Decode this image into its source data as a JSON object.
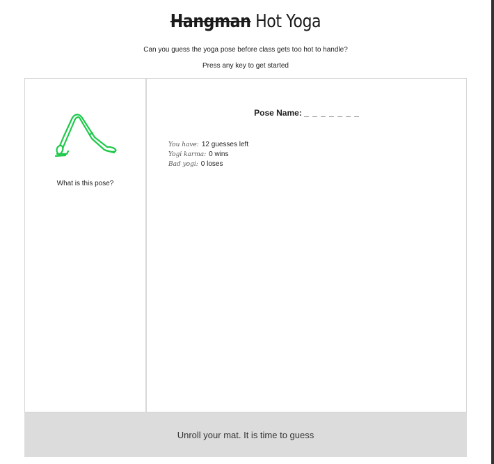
{
  "header": {
    "title_struck": "Hangman",
    "title_rest": "Hot Yoga",
    "subtitle": "Can you guess the yoga pose before class gets too hot to handle?",
    "instructions": "Press any key to get started"
  },
  "pose_panel": {
    "image_icon": "downward-dog-yoga-figure",
    "image_color": "#1ec94a",
    "question": "What is this pose?"
  },
  "game_panel": {
    "pose_name_label": "Pose Name:",
    "pose_name_blanks": "_ _ _ _ _ _ _",
    "guesses_label": "You have:",
    "guesses_value": "12 guesses left",
    "wins_label": "Yogi karma:",
    "wins_value": "0 wins",
    "losses_label": "Bad yogi:",
    "losses_value": "0 loses"
  },
  "footer": {
    "message": "Unroll your mat. It is time to guess"
  }
}
